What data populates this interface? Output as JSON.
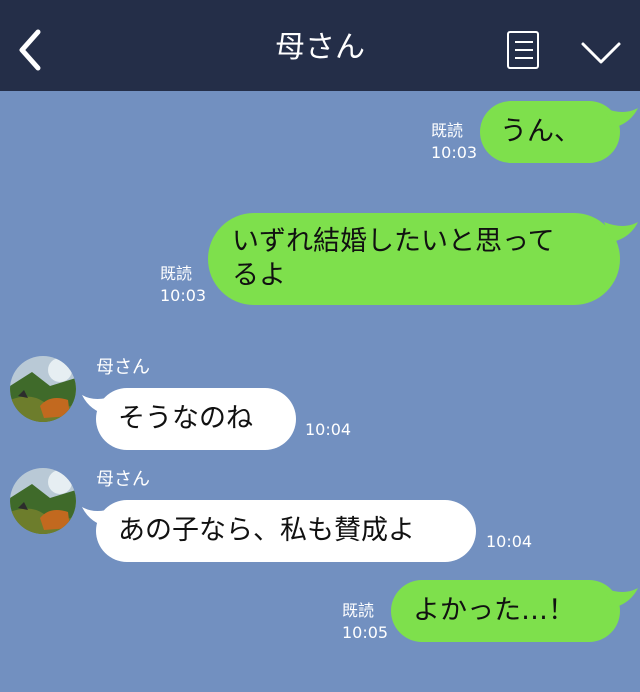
{
  "header": {
    "title": "母さん"
  },
  "messages": [
    {
      "side": "me",
      "text": "うん、",
      "read": "既読",
      "time": "10:03"
    },
    {
      "side": "me",
      "line1": "いずれ結婚したいと思って",
      "line2": "るよ",
      "read": "既読",
      "time": "10:03"
    },
    {
      "side": "them",
      "sender": "母さん",
      "text": "そうなのね",
      "time": "10:04"
    },
    {
      "side": "them",
      "sender": "母さん",
      "text": "あの子なら、私も賛成よ",
      "time": "10:04"
    },
    {
      "side": "me",
      "text": "よかった…！",
      "read": "既読",
      "time": "10:05"
    }
  ],
  "colors": {
    "header": "#242e48",
    "background": "#7290c0",
    "my_bubble": "#7ee04c",
    "their_bubble": "#ffffff"
  }
}
